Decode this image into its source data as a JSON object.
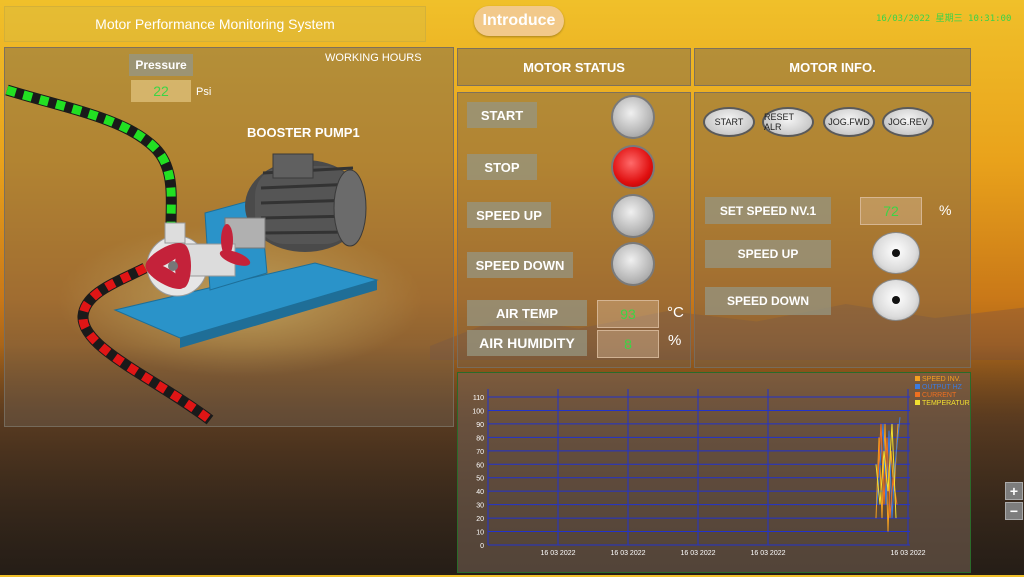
{
  "app": {
    "title": "Motor Performance Monitoring System",
    "introduce_label": "Introduce",
    "datetime": "16/03/2022 星期三 10:31:00"
  },
  "left_panel": {
    "pressure_label": "Pressure",
    "pressure_value": "22",
    "pressure_unit": "Psi",
    "working_hours_label": "WORKING HOURS",
    "pump_label": "BOOSTER PUMP1"
  },
  "motor_status": {
    "header": "MOTOR STATUS",
    "start_label": "START",
    "stop_label": "STOP",
    "speed_up_label": "SPEED UP",
    "speed_down_label": "SPEED DOWN",
    "air_temp_label": "AIR TEMP",
    "air_temp_value": "93",
    "air_temp_unit": "°C",
    "air_humidity_label": "AIR HUMIDITY",
    "air_humidity_value": "8",
    "air_humidity_unit": "%"
  },
  "motor_info": {
    "header": "MOTOR  INFO.",
    "btn_start": "START",
    "btn_reset": "RESET ALR",
    "btn_jog_fwd": "JOG.FWD",
    "btn_jog_rev": "JOG.REV",
    "set_speed_label": "SET SPEED NV.1",
    "set_speed_value": "72",
    "set_speed_unit": "%",
    "speed_up_label": "SPEED UP",
    "speed_down_label": "SPEED DOWN"
  },
  "zoom": {
    "plus": "+",
    "minus": "−"
  },
  "colors": {
    "green_text": "#3cd545",
    "lamp_red": "#e01010",
    "grid_blue": "#2233cc"
  },
  "chart_data": {
    "type": "line",
    "y_ticks": [
      "110",
      "100",
      "90",
      "80",
      "70",
      "60",
      "50",
      "40",
      "30",
      "20",
      "10",
      "0"
    ],
    "ylim": [
      0,
      110
    ],
    "x_ticks": [
      "16 03 2022",
      "16 03 2022",
      "16 03 2022",
      "16 03 2022",
      "16 03 2022"
    ],
    "legend": [
      {
        "name": "SPEED INV.",
        "color": "#f5a020"
      },
      {
        "name": "OUTPUT HZ",
        "color": "#3b7be0"
      },
      {
        "name": "CURRENT",
        "color": "#f07020"
      },
      {
        "name": "TEMPERATURE",
        "color": "#f2e030"
      }
    ],
    "grid": true
  }
}
